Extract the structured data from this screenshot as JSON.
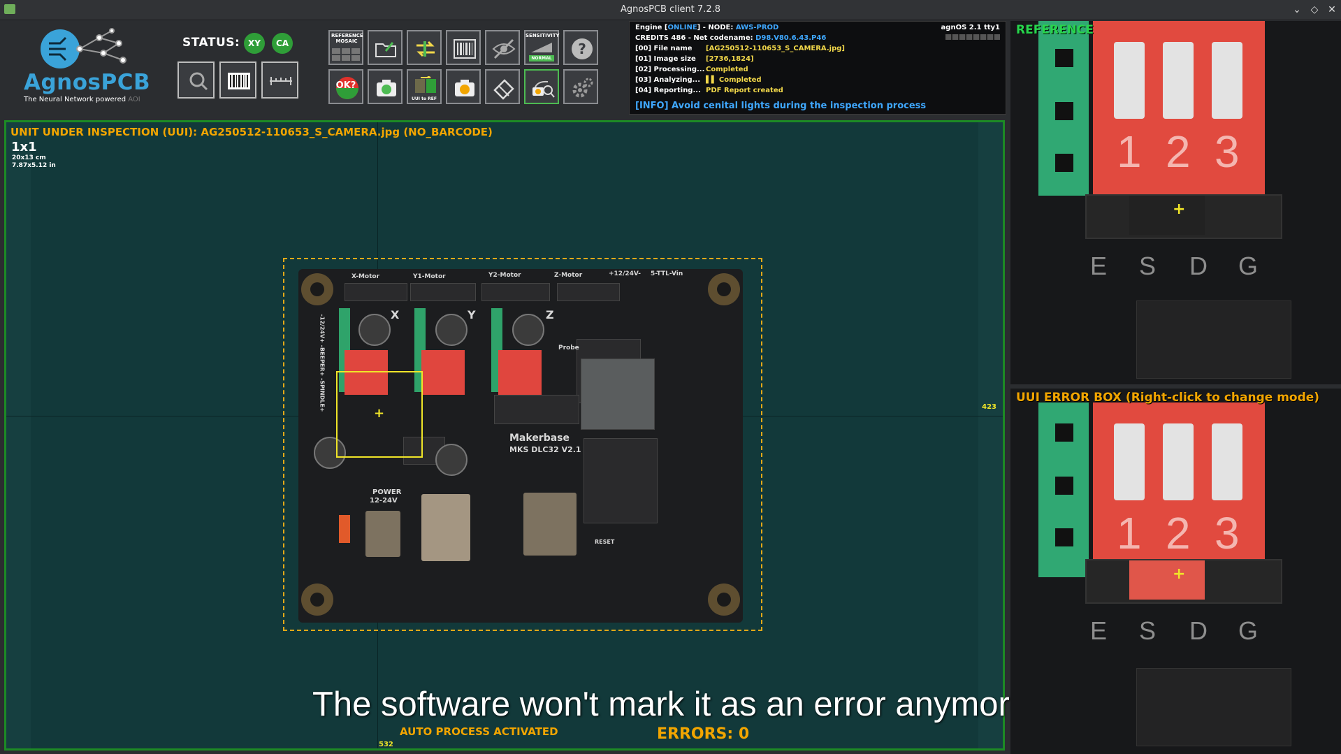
{
  "window": {
    "title": "AgnosPCB client 7.2.8",
    "controls": [
      "⌄",
      "◇",
      "✕"
    ]
  },
  "logo": {
    "brand": "AgnosPCB",
    "tagline": "The Neural Network powered",
    "tagline_suffix": "AOI"
  },
  "status": {
    "label": "STATUS:",
    "badges": [
      "XY",
      "CA"
    ]
  },
  "toolbar": {
    "reference_mosaic": "REFERENCE MOSAIC",
    "sensitivity": "SENSITIVITY",
    "sensitivity_level": "NORMAL",
    "ok_label": "OK?",
    "uui_to_ref": "UUI to REF"
  },
  "engine": {
    "line_engine_prefix": "Engine [",
    "line_engine_state": "ONLINE",
    "line_engine_mid": "] - NODE: ",
    "line_engine_node": "AWS-PROD",
    "line_credits": "CREDITS 486 - Net codename: ",
    "line_codename": "D98.V80.6.43.P46",
    "os": "agnOS 2.1 tty1",
    "steps": [
      {
        "label": "[00] File name",
        "value": "[AG250512-110653_S_CAMERA.jpg]"
      },
      {
        "label": "[01] Image size",
        "value": "[2736,1824]"
      },
      {
        "label": "[02] Processing...",
        "value": "Completed"
      },
      {
        "label": "[03] Analyzing...",
        "value": "▌▌ Completed"
      },
      {
        "label": "[04] Reporting...",
        "value": "PDF Report created"
      }
    ],
    "info": "[INFO] Avoid cenital lights during the inspection process"
  },
  "main": {
    "uui_title": "UNIT UNDER INSPECTION (UUI): AG250512-110653_S_CAMERA.jpg (NO_BARCODE)",
    "grid": "1x1",
    "dim_cm": "20x13 cm",
    "dim_in": "7.87x5.12 in",
    "coord_right": "423",
    "coord_bottom": "532",
    "caption": "The software won't mark it as an error anymore",
    "auto_process": "AUTO PROCESS ACTIVATED",
    "errors": "ERRORS: 0"
  },
  "pcb": {
    "headers": [
      "X-Motor",
      "Y1-Motor",
      "Y2-Motor",
      "Z-Motor",
      "+12/24V-",
      "5-TTL-Vin"
    ],
    "axis_labels": [
      "X",
      "Y",
      "Z"
    ],
    "probe": "Probe",
    "brand": "Makerbase",
    "model": "MKS DLC32 V2.1",
    "power": "POWER",
    "power_v": "12-24V",
    "reset": "RESET",
    "side": "-12/24V+ -BEEPER+ -SPINDLE+"
  },
  "reference": {
    "label": "REFERENCE",
    "numbers": [
      "1",
      "2",
      "3"
    ],
    "letters": [
      "E",
      "S",
      "D",
      "G"
    ]
  },
  "error_box": {
    "label": "UUI ERROR BOX (Right-click to change mode)",
    "numbers": [
      "1",
      "2",
      "3"
    ],
    "letters": [
      "E",
      "S",
      "D",
      "G"
    ]
  }
}
